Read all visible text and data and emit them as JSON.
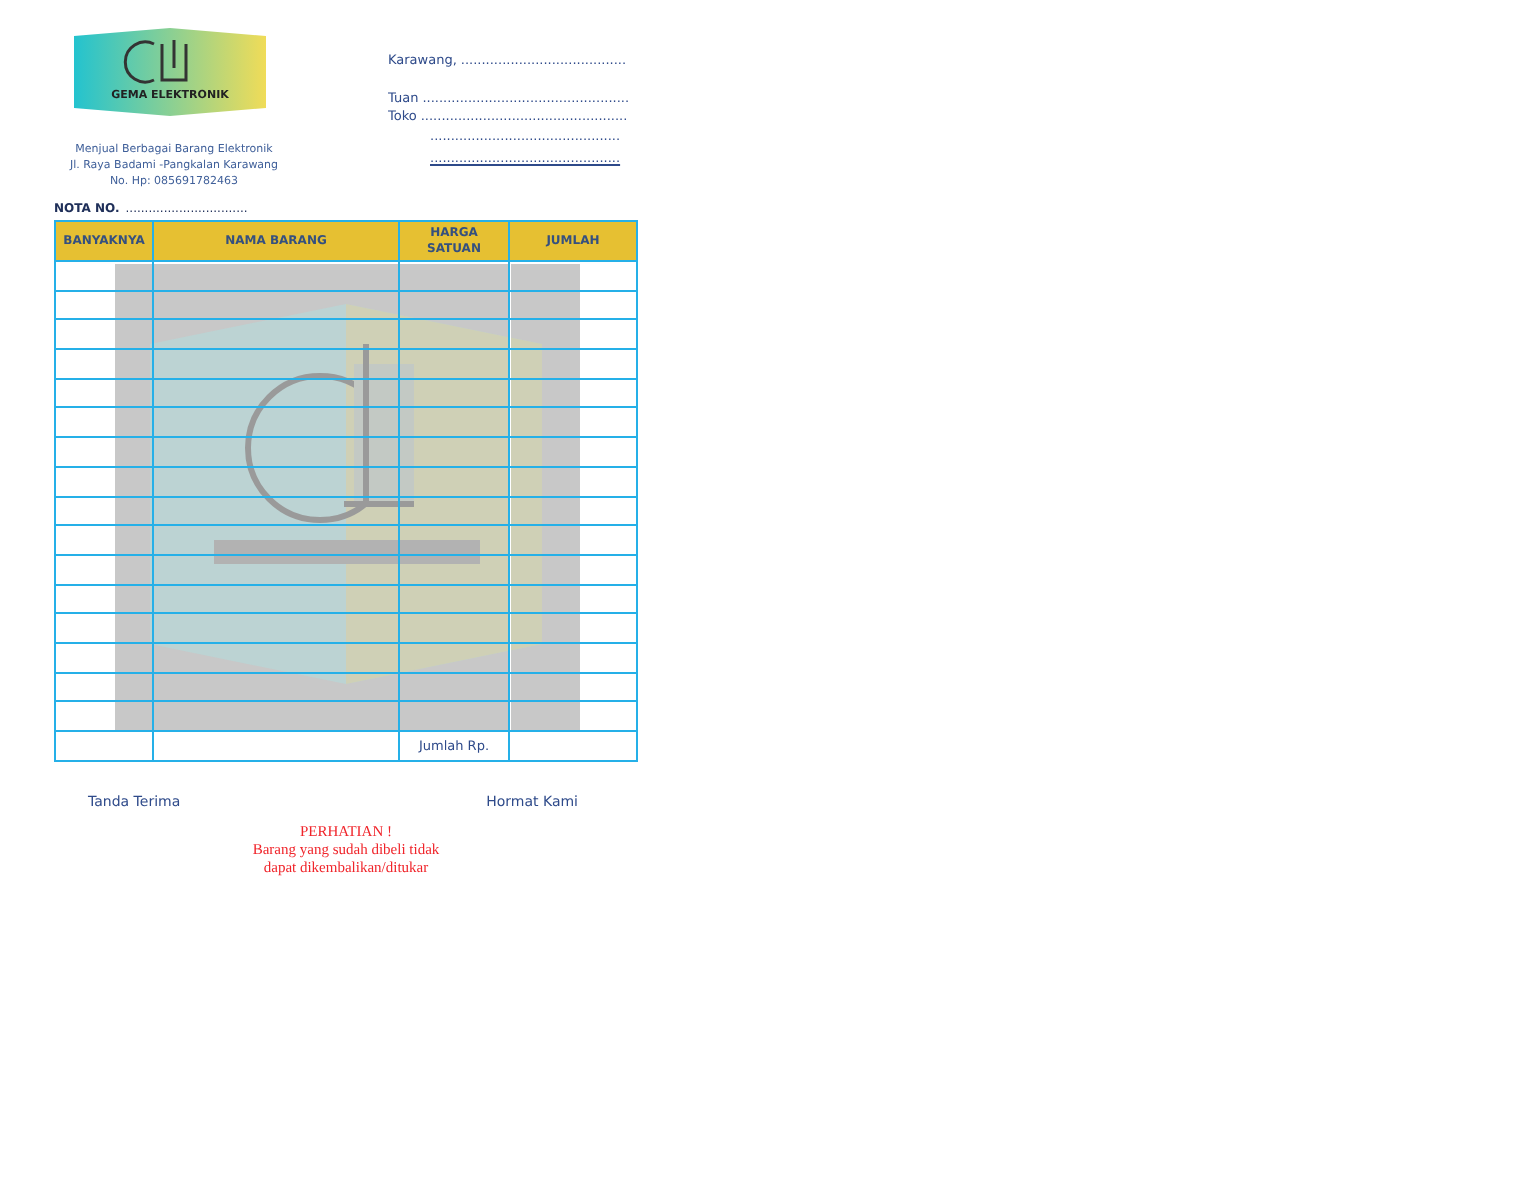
{
  "logo": {
    "brand": "GEMA ELEKTRONIK"
  },
  "shop": {
    "tagline": "Menjual Berbagai Barang Elektronik",
    "address": "Jl. Raya Badami -Pangkalan Karawang",
    "phone": "No. Hp: 085691782463"
  },
  "header_fields": [
    {
      "label": "Karawang,",
      "line": "........................................",
      "underlined": false
    },
    {
      "label": "Tuan",
      "line": "..................................................",
      "underlined": false
    },
    {
      "label": "Toko",
      "line": "..................................................",
      "underlined": false
    },
    {
      "line": "..............................................",
      "underlined": false
    },
    {
      "line": "..............................................",
      "underlined": true
    }
  ],
  "nota": {
    "label": "NOTA NO.",
    "line": "................................"
  },
  "table": {
    "columns": [
      "BANYAKNYA",
      "NAMA BARANG",
      "HARGA SATUAN",
      "JUMLAH"
    ],
    "rows": [
      {
        "kind": "blank"
      },
      {
        "kind": "blank"
      },
      {
        "kind": "blank"
      },
      {
        "kind": "blank"
      },
      {
        "kind": "blank"
      },
      {
        "kind": "blank"
      },
      {
        "kind": "blank"
      },
      {
        "kind": "blank"
      },
      {
        "kind": "blank"
      },
      {
        "kind": "blank"
      },
      {
        "kind": "blank"
      },
      {
        "kind": "blank"
      },
      {
        "kind": "blank"
      },
      {
        "kind": "blank"
      },
      {
        "kind": "blank"
      },
      {
        "kind": "blank"
      }
    ],
    "total_label": "Jumlah Rp."
  },
  "signatures": [
    "Tanda Terima",
    "Hormat Kami"
  ],
  "notice": {
    "title": "PERHATIAN !",
    "body": "Barang yang sudah dibeli tidak dapat dikembalikan/ditukar"
  }
}
